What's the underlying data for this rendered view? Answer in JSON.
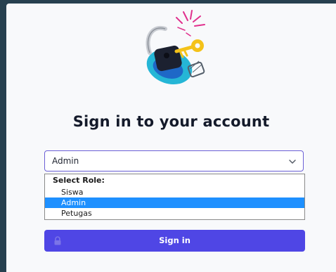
{
  "login": {
    "title": "Sign in to your account",
    "role_select": {
      "value": "Admin",
      "group_label": "Select Role:",
      "options": [
        "Siswa",
        "Admin",
        "Petugas"
      ],
      "selected": "Admin"
    },
    "submit_label": "Sign in"
  },
  "colors": {
    "accent": "#4f46e5",
    "focus_border": "#6b60d6",
    "option_highlight": "#1e90ff",
    "background": "#f8f9fb"
  },
  "icons": [
    "padlock-key-illustration",
    "chevron-down-icon",
    "lock-icon"
  ]
}
